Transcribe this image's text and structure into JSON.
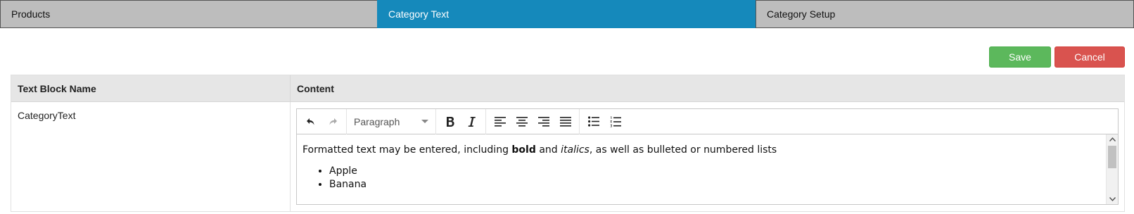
{
  "tabs": [
    {
      "label": "Products",
      "active": false
    },
    {
      "label": "Category Text",
      "active": true
    },
    {
      "label": "Category Setup",
      "active": false
    }
  ],
  "actions": {
    "save_label": "Save",
    "cancel_label": "Cancel"
  },
  "colors": {
    "tab_active": "#1589bb",
    "tab_inactive": "#bdbdbd",
    "save": "#5cb85c",
    "cancel": "#d9534f"
  },
  "table": {
    "headers": {
      "name": "Text Block Name",
      "content": "Content"
    },
    "rows": [
      {
        "name": "CategoryText"
      }
    ]
  },
  "editor": {
    "toolbar": {
      "icons": [
        "undo-icon",
        "redo-icon",
        "bold-icon",
        "italic-icon",
        "align-left-icon",
        "align-center-icon",
        "align-right-icon",
        "align-justify-icon",
        "bullet-list-icon",
        "numbered-list-icon"
      ],
      "format_value": "Paragraph"
    },
    "content": {
      "p_before_bold": "Formatted text may be entered, including ",
      "bold": "bold",
      "p_between": " and ",
      "italic": "italics",
      "p_after": ", as well as bulleted or numbered lists",
      "list": [
        "Apple",
        "Banana"
      ]
    }
  }
}
